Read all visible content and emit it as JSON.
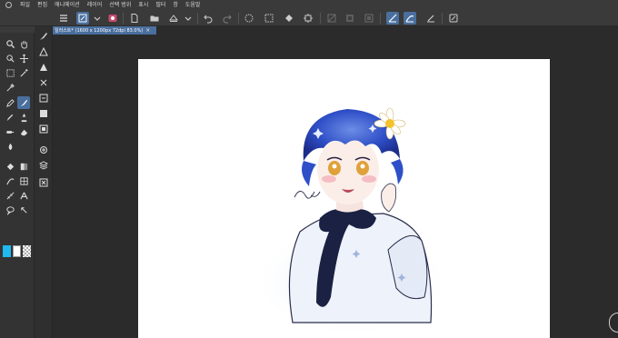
{
  "menu": {
    "items": [
      "파일",
      "편집",
      "애니메이션",
      "레이어",
      "선택 범위",
      "표시",
      "필터",
      "창",
      "도움말"
    ]
  },
  "tab": {
    "title": "일러스트* (1600 x 1200px 72dpi 83.0%)",
    "close": "×"
  },
  "toolbar": {
    "icons": [
      "hamburger-icon",
      "new-file-icon",
      "dropdown-icon",
      "app-icon",
      "new-icon",
      "open-icon",
      "save-icon",
      "dropdown-icon",
      "undo-icon",
      "redo-icon",
      "clear-icon",
      "transform-icon",
      "fill-icon",
      "crop-icon",
      "hide-selection-icon",
      "invert-selection-icon",
      "expand-selection-icon",
      "snap-ruler-icon",
      "snap-grid-icon",
      "snap-special-icon",
      "layer-settings-icon"
    ]
  },
  "palette": {
    "main_color": "#1fb8f0",
    "sub_color": "#ffffff",
    "transparent_label": "transparent"
  },
  "colors": {
    "accent": "#4a6f9e",
    "paper": "#ffffff",
    "bg": "#2b2b2b"
  }
}
